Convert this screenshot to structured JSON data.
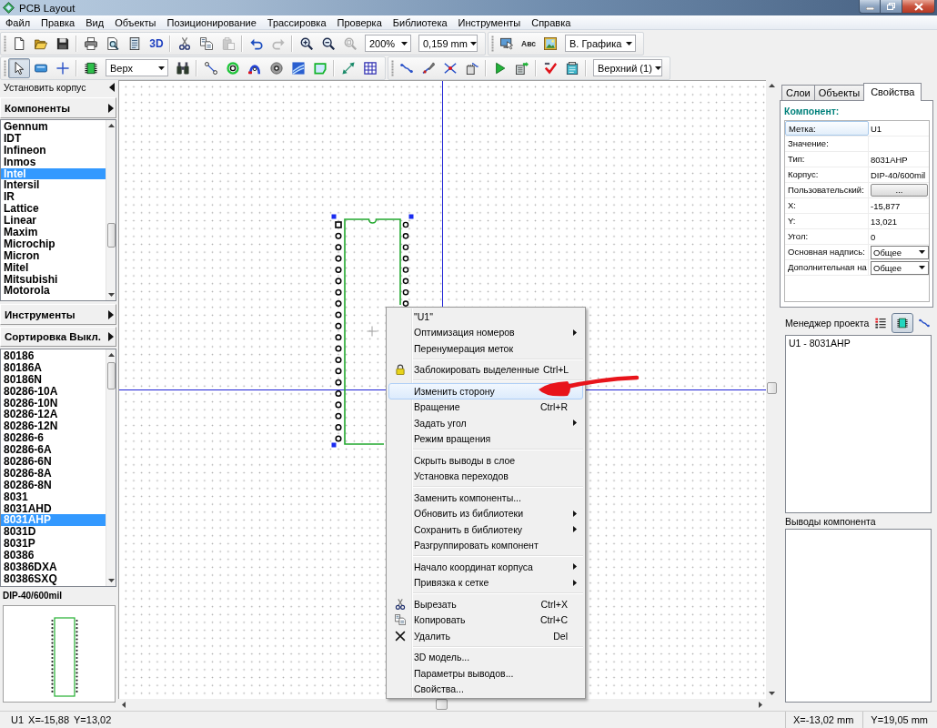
{
  "window": {
    "title": "PCB Layout"
  },
  "menu_bar": [
    "Файл",
    "Правка",
    "Вид",
    "Объекты",
    "Позиционирование",
    "Трассировка",
    "Проверка",
    "Библиотека",
    "Инструменты",
    "Справка"
  ],
  "toolbar_rows": [
    {
      "bands": [
        {
          "items": [
            {
              "kind": "icon",
              "disabled": false
            },
            {
              "kind": "icon",
              "disabled": false
            },
            {
              "kind": "icon",
              "disabled": false
            },
            {
              "kind": "separator"
            },
            {
              "kind": "icon",
              "disabled": false
            },
            {
              "kind": "icon",
              "disabled": false
            },
            {
              "kind": "icon",
              "disabled": false
            },
            {
              "kind": "text",
              "label": "3D",
              "disabled": false
            },
            {
              "kind": "separator"
            },
            {
              "kind": "icon",
              "disabled": false
            },
            {
              "kind": "icon",
              "disabled": false
            },
            {
              "kind": "icon",
              "disabled": true
            },
            {
              "kind": "separator"
            },
            {
              "kind": "icon",
              "disabled": false
            },
            {
              "kind": "icon",
              "disabled": true
            },
            {
              "kind": "separator"
            },
            {
              "kind": "icon",
              "disabled": false
            },
            {
              "kind": "icon",
              "disabled": false
            },
            {
              "kind": "icon",
              "disabled": true
            },
            {
              "kind": "combo",
              "value": "200%"
            },
            {
              "kind": "combo",
              "value": "0,159 mm"
            }
          ]
        },
        {
          "items": [
            {
              "kind": "icon",
              "disabled": false
            },
            {
              "kind": "text",
              "label": "Авс",
              "disabled": false
            },
            {
              "kind": "icon",
              "disabled": false
            },
            {
              "kind": "combo",
              "value": "В. Графика"
            }
          ]
        }
      ]
    },
    {
      "bands": [
        {
          "items": [
            {
              "kind": "icon",
              "pressed": true
            },
            {
              "kind": "icon",
              "pressed": false
            },
            {
              "kind": "icon",
              "pressed": false
            },
            {
              "kind": "separator"
            },
            {
              "kind": "icon",
              "pressed": false
            },
            {
              "kind": "combo",
              "value": "Верх"
            },
            {
              "kind": "icon",
              "pressed": false
            },
            {
              "kind": "separator"
            },
            {
              "kind": "icon",
              "pressed": false
            },
            {
              "kind": "icon",
              "pressed": false
            },
            {
              "kind": "icon",
              "pressed": false
            },
            {
              "kind": "icon",
              "pressed": false
            },
            {
              "kind": "icon",
              "pressed": false
            },
            {
              "kind": "icon",
              "pressed": false
            },
            {
              "kind": "separator"
            },
            {
              "kind": "icon",
              "pressed": false
            },
            {
              "kind": "icon",
              "pressed": false
            }
          ]
        },
        {
          "items": [
            {
              "kind": "icon",
              "pressed": false
            },
            {
              "kind": "icon",
              "pressed": false
            },
            {
              "kind": "icon",
              "pressed": false
            },
            {
              "kind": "icon",
              "pressed": false
            },
            {
              "kind": "separator"
            },
            {
              "kind": "icon",
              "pressed": false
            },
            {
              "kind": "icon",
              "pressed": false
            },
            {
              "kind": "separator"
            },
            {
              "kind": "icon",
              "pressed": false
            },
            {
              "kind": "icon",
              "pressed": false
            },
            {
              "kind": "separator"
            },
            {
              "kind": "combo",
              "value": "Верхний (1)"
            }
          ]
        }
      ]
    }
  ],
  "left_panel": {
    "title": "Установить корпус",
    "components_button": "Компоненты",
    "manufacturers": [
      {
        "name": "Gennum",
        "selected": false
      },
      {
        "name": "IDT",
        "selected": false
      },
      {
        "name": "Infineon",
        "selected": false
      },
      {
        "name": "Inmos",
        "selected": false
      },
      {
        "name": "Intel",
        "selected": true
      },
      {
        "name": "Intersil",
        "selected": false
      },
      {
        "name": "IR",
        "selected": false
      },
      {
        "name": "Lattice",
        "selected": false
      },
      {
        "name": "Linear",
        "selected": false
      },
      {
        "name": "Maxim",
        "selected": false
      },
      {
        "name": "Microchip",
        "selected": false
      },
      {
        "name": "Micron",
        "selected": false
      },
      {
        "name": "Mitel",
        "selected": false
      },
      {
        "name": "Mitsubishi",
        "selected": false
      },
      {
        "name": "Motorola",
        "selected": false
      }
    ],
    "tools_button": "Инструменты",
    "sort_button": "Сортировка Выкл.",
    "parts": [
      {
        "name": "80186",
        "selected": false
      },
      {
        "name": "80186A",
        "selected": false
      },
      {
        "name": "80186N",
        "selected": false
      },
      {
        "name": "80286-10A",
        "selected": false
      },
      {
        "name": "80286-10N",
        "selected": false
      },
      {
        "name": "80286-12A",
        "selected": false
      },
      {
        "name": "80286-12N",
        "selected": false
      },
      {
        "name": "80286-6",
        "selected": false
      },
      {
        "name": "80286-6A",
        "selected": false
      },
      {
        "name": "80286-6N",
        "selected": false
      },
      {
        "name": "80286-8A",
        "selected": false
      },
      {
        "name": "80286-8N",
        "selected": false
      },
      {
        "name": "8031",
        "selected": false
      },
      {
        "name": "8031AHD",
        "selected": false
      },
      {
        "name": "8031AHP",
        "selected": true
      },
      {
        "name": "8031D",
        "selected": false
      },
      {
        "name": "8031P",
        "selected": false
      },
      {
        "name": "80386",
        "selected": false
      },
      {
        "name": "80386DXA",
        "selected": false
      },
      {
        "name": "80386SXQ",
        "selected": false
      }
    ],
    "footprint": "DIP-40/600mil"
  },
  "canvas": {
    "component": {
      "selected": true
    }
  },
  "context_menu": {
    "items": [
      {
        "kind": "item",
        "label": "\"U1\"",
        "selected": false,
        "submenu": false,
        "icon": false
      },
      {
        "kind": "item",
        "label": "Оптимизация номеров",
        "selected": false,
        "submenu": true,
        "icon": false
      },
      {
        "kind": "item",
        "label": "Перенумерация меток",
        "selected": false,
        "submenu": false,
        "icon": false
      },
      {
        "kind": "separator"
      },
      {
        "kind": "item",
        "label": "Заблокировать выделенные",
        "shortcut": "Ctrl+L",
        "selected": false,
        "submenu": false,
        "icon": true
      },
      {
        "kind": "separator"
      },
      {
        "kind": "item",
        "label": "Изменить сторону",
        "selected": true,
        "submenu": false,
        "icon": false
      },
      {
        "kind": "item",
        "label": "Вращение",
        "shortcut": "Ctrl+R",
        "selected": false,
        "submenu": false,
        "icon": false
      },
      {
        "kind": "item",
        "label": "Задать угол",
        "selected": false,
        "submenu": true,
        "icon": false
      },
      {
        "kind": "item",
        "label": "Режим вращения",
        "selected": false,
        "submenu": false,
        "icon": false
      },
      {
        "kind": "separator"
      },
      {
        "kind": "item",
        "label": "Скрыть выводы в слое",
        "selected": false,
        "submenu": false,
        "icon": false
      },
      {
        "kind": "item",
        "label": "Установка переходов",
        "selected": false,
        "submenu": false,
        "icon": false
      },
      {
        "kind": "separator"
      },
      {
        "kind": "item",
        "label": "Заменить компоненты...",
        "selected": false,
        "submenu": false,
        "icon": false
      },
      {
        "kind": "item",
        "label": "Обновить из библиотеки",
        "selected": false,
        "submenu": true,
        "icon": false
      },
      {
        "kind": "item",
        "label": "Сохранить в библиотеку",
        "selected": false,
        "submenu": true,
        "icon": false
      },
      {
        "kind": "item",
        "label": "Разгруппировать компонент",
        "selected": false,
        "submenu": false,
        "icon": false
      },
      {
        "kind": "separator"
      },
      {
        "kind": "item",
        "label": "Начало координат корпуса",
        "selected": false,
        "submenu": true,
        "icon": false
      },
      {
        "kind": "item",
        "label": "Привязка к сетке",
        "selected": false,
        "submenu": true,
        "icon": false
      },
      {
        "kind": "separator"
      },
      {
        "kind": "item",
        "label": "Вырезать",
        "shortcut": "Ctrl+X",
        "selected": false,
        "submenu": false,
        "icon": true
      },
      {
        "kind": "item",
        "label": "Копировать",
        "shortcut": "Ctrl+C",
        "selected": false,
        "submenu": false,
        "icon": true
      },
      {
        "kind": "item",
        "label": "Удалить",
        "shortcut": "Del",
        "selected": false,
        "submenu": false,
        "icon": true
      },
      {
        "kind": "separator"
      },
      {
        "kind": "item",
        "label": "3D модель...",
        "selected": false,
        "submenu": false,
        "icon": false
      },
      {
        "kind": "item",
        "label": "Параметры выводов...",
        "selected": false,
        "submenu": false,
        "icon": false
      },
      {
        "kind": "item",
        "label": "Свойства...",
        "selected": false,
        "submenu": false,
        "icon": false
      }
    ]
  },
  "right_panel": {
    "tabs": [
      {
        "label": "Слои",
        "selected": false
      },
      {
        "label": "Объекты",
        "selected": false
      },
      {
        "label": "Свойства",
        "selected": true
      }
    ],
    "section_title": "Компонент:",
    "properties": [
      {
        "kind": "text",
        "label": "Метка:",
        "value": "U1",
        "selected": true
      },
      {
        "kind": "text",
        "label": "Значение:",
        "selected": false
      },
      {
        "kind": "text",
        "label": "Тип:",
        "value": "8031AHP",
        "selected": false
      },
      {
        "kind": "text",
        "label": "Корпус:",
        "value": "DIP-40/600mil",
        "selected": false
      },
      {
        "kind": "button",
        "label": "Пользовательский:",
        "value": "...",
        "selected": false
      },
      {
        "kind": "text",
        "label": "X:",
        "value": "-15,877",
        "selected": false
      },
      {
        "kind": "text",
        "label": "Y:",
        "value": "13,021",
        "selected": false
      },
      {
        "kind": "text",
        "label": "Угол:",
        "value": "0",
        "selected": false
      },
      {
        "kind": "combo",
        "label": "Основная надпись:",
        "value": "Общее",
        "selected": false
      },
      {
        "kind": "combo",
        "label": "Дополнительная на",
        "value": "Общее",
        "selected": false
      }
    ],
    "project_manager": {
      "title": "Менеджер проекта",
      "views": [
        {
          "pressed": false
        },
        {
          "pressed": true
        },
        {
          "pressed": false
        }
      ],
      "items": [
        "U1 - 8031AHP"
      ]
    },
    "pins_title": "Выводы компонента"
  },
  "status_bar": {
    "left": [
      "U1",
      "X=-15,88",
      "Y=13,02"
    ],
    "panels": [
      "X=-13,02 mm",
      "Y=19,05 mm"
    ]
  }
}
